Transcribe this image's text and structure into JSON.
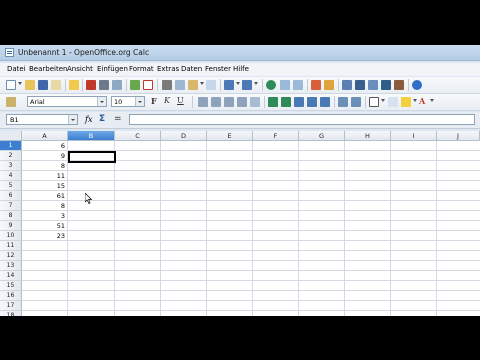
{
  "window": {
    "title": "Unbenannt 1 - OpenOffice.org Calc"
  },
  "menu": [
    "Datei",
    "Bearbeiten",
    "Ansicht",
    "Einfügen",
    "Format",
    "Extras",
    "Daten",
    "Fenster",
    "Hilfe"
  ],
  "toolbar": {
    "font_name": "Arial",
    "font_size": "10"
  },
  "formula_bar": {
    "name_box": "B1",
    "fx_label": "fx",
    "sum_label": "Σ",
    "equals_label": "=",
    "content": ""
  },
  "sheet": {
    "columns": [
      "A",
      "B",
      "C",
      "D",
      "E",
      "F",
      "G",
      "H",
      "I",
      "J"
    ],
    "selected_column": "B",
    "selected_row": 1,
    "rows": [
      "1",
      "2",
      "3",
      "4",
      "5",
      "6",
      "7",
      "8",
      "9",
      "10",
      "11",
      "12",
      "13",
      "14",
      "15",
      "16",
      "17",
      "18"
    ],
    "column_a_values": [
      "6",
      "9",
      "8",
      "11",
      "15",
      "61",
      "8",
      "3",
      "51",
      "23"
    ]
  },
  "colors": {
    "selection": "#3c7fd0",
    "chrome": "#dce7f3"
  }
}
